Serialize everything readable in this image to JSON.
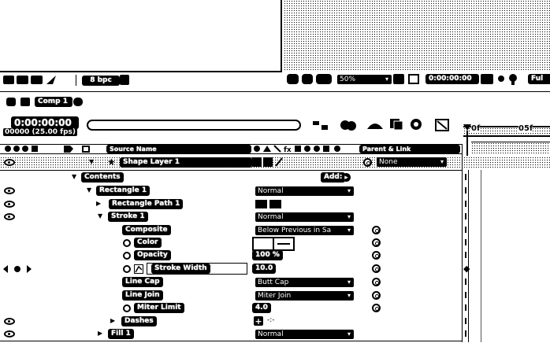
{
  "top": {
    "project_bpc": "8 bpc",
    "viewer_zoom": "50%",
    "viewer_time": "0:00:00:00",
    "viewer_res": "Ful"
  },
  "comp": {
    "tab_label": "Comp 1",
    "timecode": "0:00:00:00",
    "frame_info": "00000 (25.00 fps)",
    "search_placeholder": "",
    "add_label": "Add:"
  },
  "columns": {
    "source_name": "Source Name",
    "parent_link": "Parent & Link"
  },
  "timeline_ruler": {
    "start": "0f",
    "mark": "05f"
  },
  "layer": {
    "name": "Shape Layer 1",
    "parent": "None"
  },
  "rows": [
    {
      "label": "Contents",
      "value": ""
    },
    {
      "label": "Rectangle 1",
      "value": "Normal"
    },
    {
      "label": "Rectangle Path 1",
      "value": ""
    },
    {
      "label": "Stroke 1",
      "value": "Normal"
    },
    {
      "label": "Composite",
      "value": "Below Previous in Sa"
    },
    {
      "label": "Color",
      "value": ""
    },
    {
      "label": "Opacity",
      "value": "100 %"
    },
    {
      "label": "Stroke Width",
      "value": "10.0"
    },
    {
      "label": "Line Cap",
      "value": "Butt Cap"
    },
    {
      "label": "Line Join",
      "value": "Miter Join"
    },
    {
      "label": "Miter Limit",
      "value": "4.0"
    },
    {
      "label": "Dashes",
      "value": ""
    },
    {
      "label": "Fill 1",
      "value": "Normal"
    }
  ]
}
